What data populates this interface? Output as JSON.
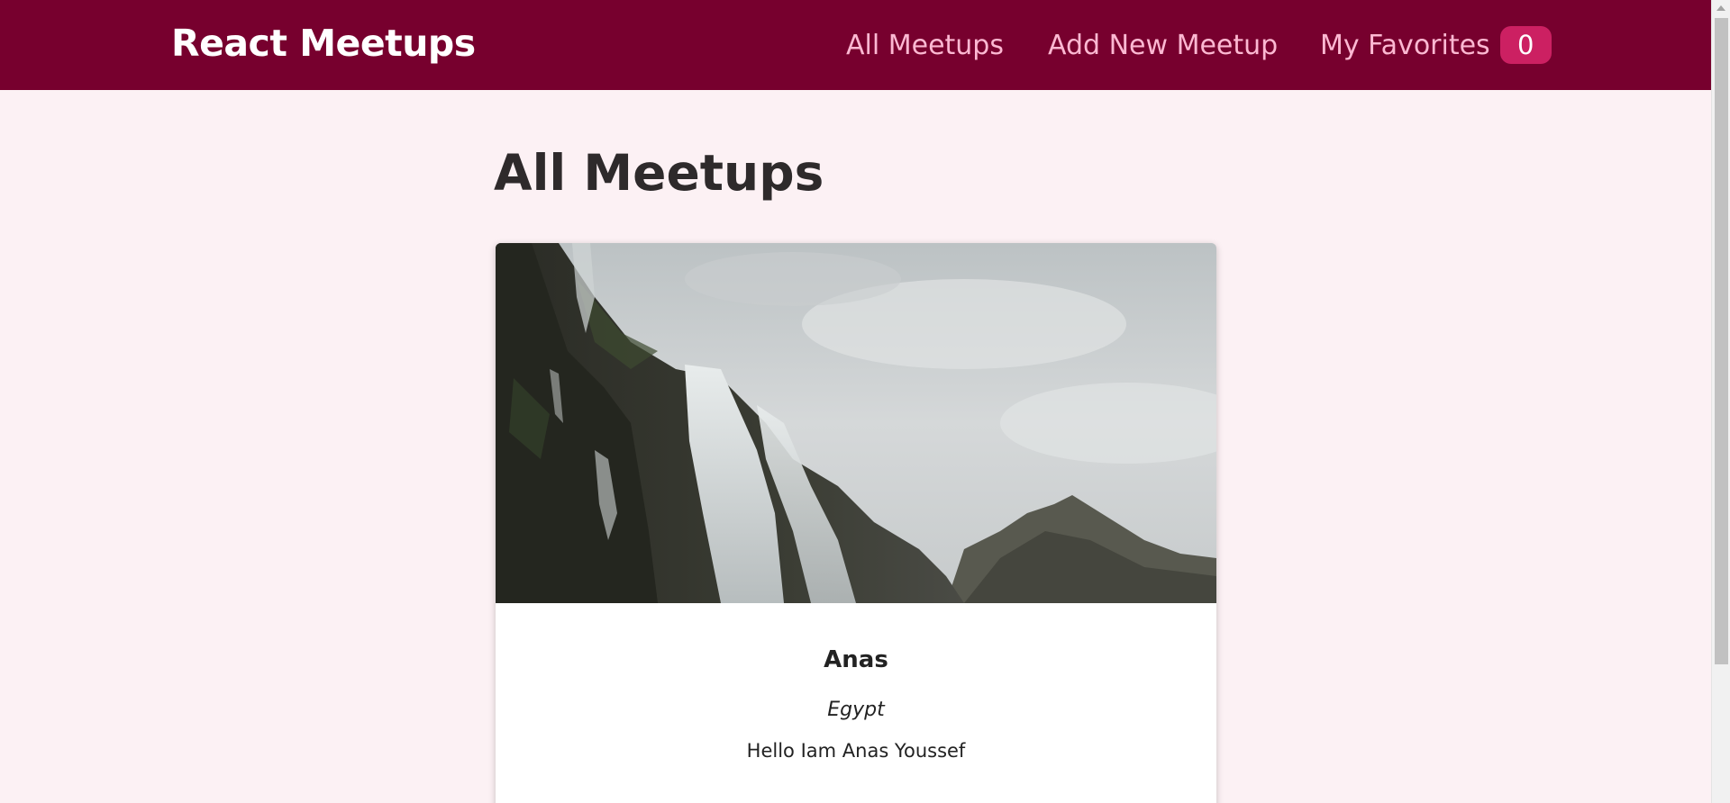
{
  "header": {
    "logo": "React Meetups",
    "nav": {
      "all_meetups": "All Meetups",
      "add_new_meetup": "Add New Meetup",
      "my_favorites": "My Favorites",
      "favorites_count": "0"
    }
  },
  "main": {
    "title": "All Meetups",
    "meetups": [
      {
        "title": "Anas",
        "address": "Egypt",
        "description": "Hello Iam Anas Youssef"
      }
    ]
  },
  "colors": {
    "header_bg": "#77002e",
    "nav_text": "#fcb8d2",
    "badge_bg": "#cc2062",
    "page_bg": "#fcf1f4"
  }
}
